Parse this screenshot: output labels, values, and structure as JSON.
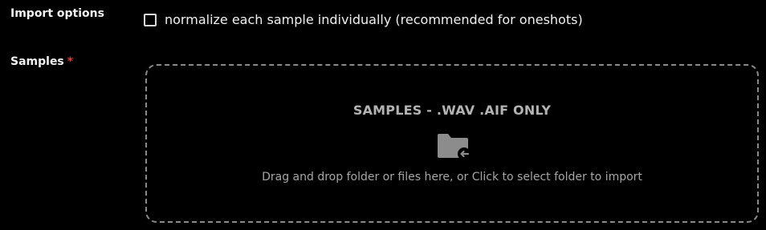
{
  "import_options": {
    "label": "Import options",
    "normalize_checkbox": {
      "label": "normalize each sample individually (recommended for oneshots)",
      "checked": false
    }
  },
  "samples": {
    "label": "Samples",
    "required_marker": "*",
    "dropzone": {
      "title": "SAMPLES - .WAV .AIF ONLY",
      "icon": "folder-import-icon",
      "hint": "Drag and drop folder or files here, or Click to select folder to import"
    }
  },
  "colors": {
    "background": "#000000",
    "required": "#e53935",
    "dropzone_border": "#8a8a8a",
    "icon": "#8c8c8c"
  }
}
